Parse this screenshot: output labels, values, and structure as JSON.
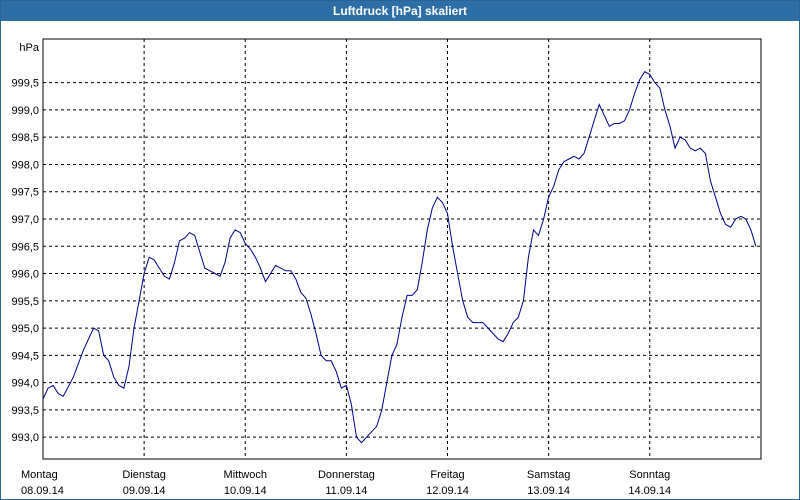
{
  "window": {
    "title": "Luftdruck [hPa] skaliert"
  },
  "chart_data": {
    "type": "line",
    "title": "Luftdruck [hPa] skaliert",
    "ylabel": "hPa",
    "ylim": [
      992.6,
      1000.3
    ],
    "y_ticks": [
      "993,0",
      "993,5",
      "994,0",
      "994,5",
      "995,0",
      "995,5",
      "996,0",
      "996,5",
      "997,0",
      "997,5",
      "998,0",
      "998,5",
      "999,0",
      "999,5"
    ],
    "y_tick_values": [
      993.0,
      993.5,
      994.0,
      994.5,
      995.0,
      995.5,
      996.0,
      996.5,
      997.0,
      997.5,
      998.0,
      998.5,
      999.0,
      999.5
    ],
    "x_ticks": [
      {
        "day": "Montag",
        "date": "08.09.14"
      },
      {
        "day": "Dienstag",
        "date": "09.09.14"
      },
      {
        "day": "Mittwoch",
        "date": "10.09.14"
      },
      {
        "day": "Donnerstag",
        "date": "11.09.14"
      },
      {
        "day": "Freitag",
        "date": "12.09.14"
      },
      {
        "day": "Samstag",
        "date": "13.09.14"
      },
      {
        "day": "Sonntag",
        "date": "14.09.14"
      }
    ],
    "xlim": [
      0,
      7.1
    ],
    "grid": true,
    "line_color": "#00008b",
    "series": [
      {
        "x": [
          0,
          0.05,
          0.1,
          0.15,
          0.2,
          0.3,
          0.4,
          0.45,
          0.5,
          0.55,
          0.6,
          0.65,
          0.7,
          0.75,
          0.8,
          0.85,
          0.9,
          0.95,
          1.0,
          1.05,
          1.1,
          1.15,
          1.2,
          1.25,
          1.3,
          1.35,
          1.4,
          1.45,
          1.5,
          1.55,
          1.6,
          1.65,
          1.7,
          1.75,
          1.8,
          1.85,
          1.9,
          1.95,
          2.0,
          2.05,
          2.1,
          2.15,
          2.2,
          2.3,
          2.4,
          2.45,
          2.5,
          2.55,
          2.6,
          2.65,
          2.7,
          2.75,
          2.8,
          2.85,
          2.9,
          2.95,
          3.0,
          3.05,
          3.1,
          3.15,
          3.2,
          3.25,
          3.3,
          3.35,
          3.4,
          3.45,
          3.5,
          3.55,
          3.6,
          3.65,
          3.7,
          3.75,
          3.8,
          3.85,
          3.9,
          3.95,
          4.0,
          4.05,
          4.1,
          4.15,
          4.2,
          4.25,
          4.3,
          4.35,
          4.4,
          4.45,
          4.5,
          4.55,
          4.6,
          4.65,
          4.7,
          4.75,
          4.8,
          4.85,
          4.9,
          4.95,
          5.0,
          5.05,
          5.1,
          5.15,
          5.2,
          5.25,
          5.3,
          5.35,
          5.4,
          5.45,
          5.5,
          5.55,
          5.6,
          5.65,
          5.7,
          5.75,
          5.8,
          5.85,
          5.9,
          5.95,
          6.0,
          6.05,
          6.1,
          6.15,
          6.2,
          6.25,
          6.3,
          6.35,
          6.4,
          6.45,
          6.5,
          6.55,
          6.6,
          6.65,
          6.7,
          6.75,
          6.8,
          6.85,
          6.9,
          6.95,
          7.0,
          7.05
        ],
        "y": [
          993.7,
          993.9,
          993.95,
          993.8,
          993.75,
          994.1,
          994.6,
          994.8,
          995.0,
          994.95,
          994.5,
          994.4,
          994.1,
          993.95,
          993.9,
          994.3,
          995.0,
          995.5,
          996.0,
          996.3,
          996.25,
          996.1,
          995.95,
          995.9,
          996.2,
          996.6,
          996.65,
          996.75,
          996.7,
          996.4,
          996.1,
          996.05,
          996.0,
          995.95,
          996.2,
          996.65,
          996.8,
          996.75,
          996.55,
          996.45,
          996.3,
          996.1,
          995.85,
          996.15,
          996.05,
          996.05,
          995.9,
          995.65,
          995.55,
          995.25,
          994.9,
          994.5,
          994.4,
          994.4,
          994.2,
          993.9,
          993.95,
          993.6,
          993.0,
          992.9,
          993.0,
          993.1,
          993.2,
          993.5,
          994.0,
          994.5,
          994.7,
          995.2,
          995.6,
          995.6,
          995.7,
          996.2,
          996.8,
          997.2,
          997.4,
          997.3,
          997.1,
          996.5,
          996.0,
          995.5,
          995.2,
          995.1,
          995.1,
          995.1,
          995.0,
          994.9,
          994.8,
          994.75,
          994.9,
          995.1,
          995.2,
          995.5,
          996.3,
          996.8,
          996.7,
          997.0,
          997.4,
          997.6,
          997.9,
          998.05,
          998.1,
          998.15,
          998.1,
          998.2,
          998.5,
          998.8,
          999.1,
          998.9,
          998.7,
          998.75,
          998.75,
          998.8,
          999.0,
          999.3,
          999.55,
          999.7,
          999.65,
          999.5,
          999.4,
          999.0,
          998.7,
          998.3,
          998.5,
          998.45,
          998.3,
          998.25,
          998.3,
          998.2,
          997.7,
          997.4,
          997.1,
          996.9,
          996.85,
          997.0,
          997.05,
          997.0,
          996.8,
          996.5
        ]
      }
    ]
  }
}
